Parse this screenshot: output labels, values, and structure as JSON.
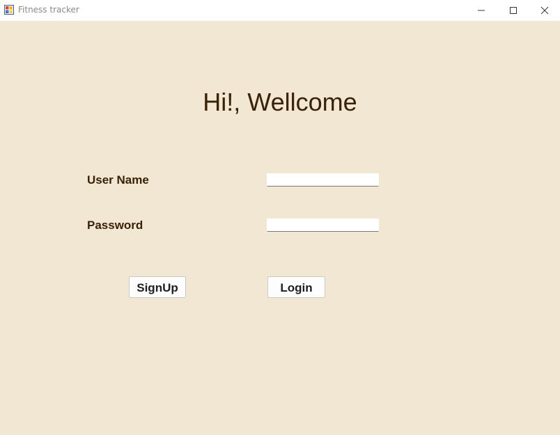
{
  "window": {
    "title": "Fitness tracker",
    "app_icon": "app-icon",
    "controls": [
      "minimize-icon",
      "maximize-icon",
      "close-icon"
    ]
  },
  "colors": {
    "background": "#f2e7d3",
    "text": "#3a2208"
  },
  "form": {
    "heading": "Hi!, Wellcome",
    "username_label": "User Name",
    "username_value": "",
    "password_label": "Password",
    "password_value": "",
    "signup_label": "SignUp",
    "login_label": "Login"
  }
}
